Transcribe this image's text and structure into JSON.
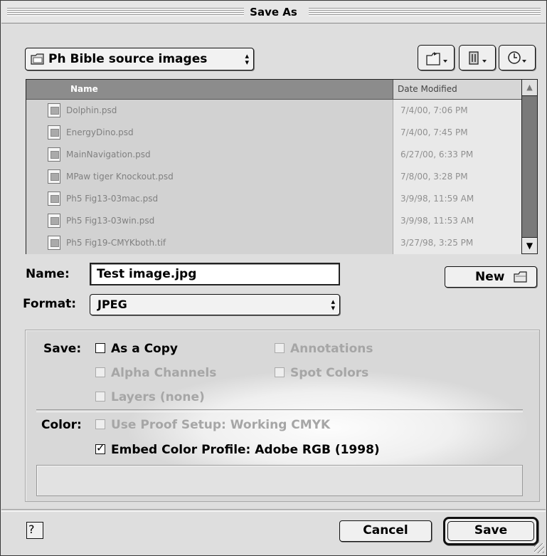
{
  "window": {
    "title": "Save As"
  },
  "location": {
    "label": "Ph Bible source images"
  },
  "toolbar": {
    "icons": [
      "folder-shortcut-icon",
      "favorites-icon",
      "recent-icon"
    ]
  },
  "file_list": {
    "columns": [
      "Name",
      "Date Modified"
    ],
    "rows": [
      {
        "name": "Dolphin.psd",
        "date": "7/4/00, 7:06 PM"
      },
      {
        "name": "EnergyDino.psd",
        "date": "7/4/00, 7:45 PM"
      },
      {
        "name": "MainNavigation.psd",
        "date": "6/27/00, 6:33 PM"
      },
      {
        "name": "MPaw tiger Knockout.psd",
        "date": "7/8/00, 3:28 PM"
      },
      {
        "name": "Ph5 Fig13-03mac.psd",
        "date": "3/9/98, 11:59 AM"
      },
      {
        "name": "Ph5 Fig13-03win.psd",
        "date": "3/9/98, 11:53 AM"
      },
      {
        "name": "Ph5 Fig19-CMYKboth.tif",
        "date": "3/27/98, 3:25 PM"
      }
    ]
  },
  "name_field": {
    "label": "Name:",
    "value": "Test image.jpg"
  },
  "new_button": {
    "label": "New"
  },
  "format": {
    "label": "Format:",
    "value": "JPEG"
  },
  "save_options": {
    "label": "Save:",
    "as_a_copy": "As a Copy",
    "annotations": "Annotations",
    "alpha_channels": "Alpha Channels",
    "spot_colors": "Spot Colors",
    "layers": "Layers (none)"
  },
  "color_options": {
    "label": "Color:",
    "use_proof_setup": "Use Proof Setup: Working CMYK",
    "embed_profile": "Embed Color Profile: Adobe RGB (1998)"
  },
  "buttons": {
    "help": "?",
    "cancel": "Cancel",
    "save": "Save"
  }
}
